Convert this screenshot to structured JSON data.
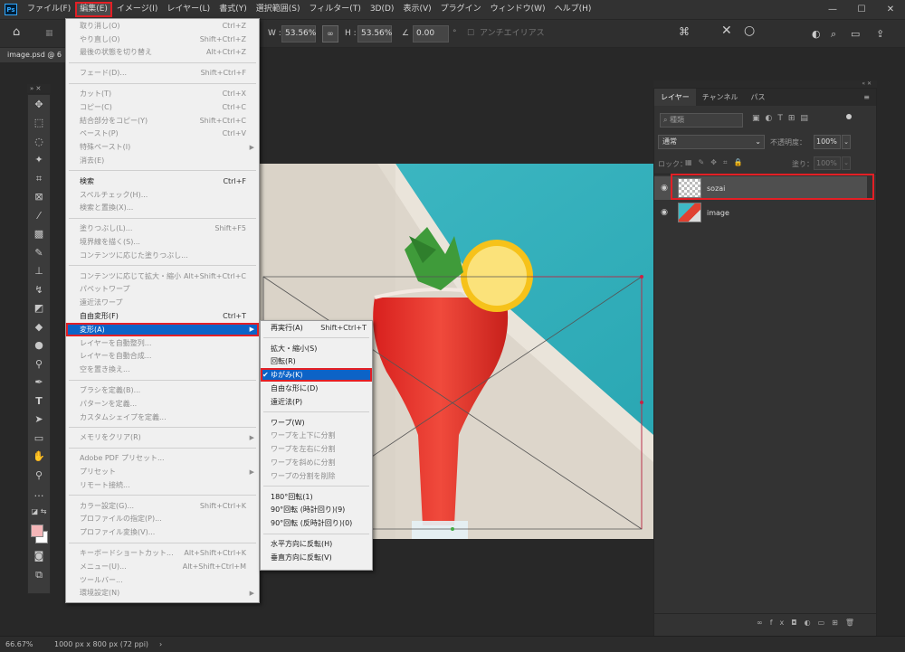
{
  "app": {
    "logo": "Ps"
  },
  "menubar": {
    "items": [
      "ファイル(F)",
      "編集(E)",
      "イメージ(I)",
      "レイヤー(L)",
      "書式(Y)",
      "選択範囲(S)",
      "フィルター(T)",
      "3D(D)",
      "表示(V)",
      "プラグイン",
      "ウィンドウ(W)",
      "ヘルプ(H)"
    ],
    "active_index": 1
  },
  "window_controls": {
    "minimize": "—",
    "restore": "☐",
    "close": "✕"
  },
  "options_bar": {
    "w_label": "W :",
    "w_value": "53.56%",
    "link_icon": "link-icon",
    "h_label": "H :",
    "h_value": "53.56%",
    "angle_value": "0.00",
    "angle_unit": "°",
    "antialias_label": "アンチエイリアス"
  },
  "document": {
    "tab_title": "image.psd @ 6"
  },
  "edit_menu": {
    "groups": [
      [
        {
          "label": "取り消し(O)",
          "shortcut": "Ctrl+Z",
          "enabled": false
        },
        {
          "label": "やり直し(O)",
          "shortcut": "Shift+Ctrl+Z",
          "enabled": false
        },
        {
          "label": "最後の状態を切り替え",
          "shortcut": "Alt+Ctrl+Z",
          "enabled": false
        }
      ],
      [
        {
          "label": "フェード(D)...",
          "shortcut": "Shift+Ctrl+F",
          "enabled": false
        }
      ],
      [
        {
          "label": "カット(T)",
          "shortcut": "Ctrl+X",
          "enabled": false
        },
        {
          "label": "コピー(C)",
          "shortcut": "Ctrl+C",
          "enabled": false
        },
        {
          "label": "結合部分をコピー(Y)",
          "shortcut": "Shift+Ctrl+C",
          "enabled": false
        },
        {
          "label": "ペースト(P)",
          "shortcut": "Ctrl+V",
          "enabled": false
        },
        {
          "label": "特殊ペースト(I)",
          "shortcut": "",
          "enabled": false,
          "submenu": true
        },
        {
          "label": "消去(E)",
          "shortcut": "",
          "enabled": false
        }
      ],
      [
        {
          "label": "検索",
          "shortcut": "Ctrl+F",
          "enabled": true
        },
        {
          "label": "スペルチェック(H)...",
          "shortcut": "",
          "enabled": false
        },
        {
          "label": "検索と置換(X)...",
          "shortcut": "",
          "enabled": false
        }
      ],
      [
        {
          "label": "塗りつぶし(L)...",
          "shortcut": "Shift+F5",
          "enabled": false
        },
        {
          "label": "境界線を描く(S)...",
          "shortcut": "",
          "enabled": false
        },
        {
          "label": "コンテンツに応じた塗りつぶし...",
          "shortcut": "",
          "enabled": false
        }
      ],
      [
        {
          "label": "コンテンツに応じて拡大・縮小",
          "shortcut": "Alt+Shift+Ctrl+C",
          "enabled": false
        },
        {
          "label": "パペットワープ",
          "shortcut": "",
          "enabled": false
        },
        {
          "label": "遠近法ワープ",
          "shortcut": "",
          "enabled": false
        },
        {
          "label": "自由変形(F)",
          "shortcut": "Ctrl+T",
          "enabled": true
        },
        {
          "label": "変形(A)",
          "shortcut": "",
          "enabled": true,
          "submenu": true,
          "highlighted": true
        },
        {
          "label": "レイヤーを自動整列...",
          "shortcut": "",
          "enabled": false
        },
        {
          "label": "レイヤーを自動合成...",
          "shortcut": "",
          "enabled": false
        },
        {
          "label": "空を置き換え...",
          "shortcut": "",
          "enabled": false
        }
      ],
      [
        {
          "label": "ブラシを定義(B)...",
          "shortcut": "",
          "enabled": false
        },
        {
          "label": "パターンを定義...",
          "shortcut": "",
          "enabled": false
        },
        {
          "label": "カスタムシェイプを定義...",
          "shortcut": "",
          "enabled": false
        }
      ],
      [
        {
          "label": "メモリをクリア(R)",
          "shortcut": "",
          "enabled": false,
          "submenu": true
        }
      ],
      [
        {
          "label": "Adobe PDF プリセット...",
          "shortcut": "",
          "enabled": false
        },
        {
          "label": "プリセット",
          "shortcut": "",
          "enabled": false,
          "submenu": true
        },
        {
          "label": "リモート接続...",
          "shortcut": "",
          "enabled": false
        }
      ],
      [
        {
          "label": "カラー設定(G)...",
          "shortcut": "Shift+Ctrl+K",
          "enabled": false
        },
        {
          "label": "プロファイルの指定(P)...",
          "shortcut": "",
          "enabled": false
        },
        {
          "label": "プロファイル変換(V)...",
          "shortcut": "",
          "enabled": false
        }
      ],
      [
        {
          "label": "キーボードショートカット...",
          "shortcut": "Alt+Shift+Ctrl+K",
          "enabled": false
        },
        {
          "label": "メニュー(U)...",
          "shortcut": "Alt+Shift+Ctrl+M",
          "enabled": false
        },
        {
          "label": "ツールバー...",
          "shortcut": "",
          "enabled": false
        },
        {
          "label": "環境設定(N)",
          "shortcut": "",
          "enabled": false,
          "submenu": true
        }
      ]
    ]
  },
  "transform_submenu": {
    "groups": [
      [
        {
          "label": "再実行(A)",
          "shortcut": "Shift+Ctrl+T",
          "enabled": true
        }
      ],
      [
        {
          "label": "拡大・縮小(S)",
          "enabled": true
        },
        {
          "label": "回転(R)",
          "enabled": true
        },
        {
          "label": "ゆがみ(K)",
          "enabled": true,
          "checked": true,
          "highlighted": true
        },
        {
          "label": "自由な形に(D)",
          "enabled": true
        },
        {
          "label": "遠近法(P)",
          "enabled": true
        }
      ],
      [
        {
          "label": "ワープ(W)",
          "enabled": true
        },
        {
          "label": "ワープを上下に分割",
          "enabled": false
        },
        {
          "label": "ワープを左右に分割",
          "enabled": false
        },
        {
          "label": "ワープを斜めに分割",
          "enabled": false
        },
        {
          "label": "ワープの分割を削除",
          "enabled": false
        }
      ],
      [
        {
          "label": "180°回転(1)",
          "enabled": true
        },
        {
          "label": "90°回転 (時計回り)(9)",
          "enabled": true
        },
        {
          "label": "90°回転 (反時計回り)(0)",
          "enabled": true
        }
      ],
      [
        {
          "label": "水平方向に反転(H)",
          "enabled": true
        },
        {
          "label": "垂直方向に反転(V)",
          "enabled": true
        }
      ]
    ]
  },
  "layers_panel": {
    "tabs": [
      "レイヤー",
      "チャンネル",
      "パス"
    ],
    "search_placeholder": "種類",
    "blend_mode": "通常",
    "opacity_label": "不透明度：",
    "opacity_value": "100%",
    "lock_label": "ロック：",
    "fill_label": "塗り：",
    "fill_value": "100%",
    "layers": [
      {
        "name": "sozai",
        "selected": true
      },
      {
        "name": "image",
        "selected": false
      }
    ]
  },
  "status": {
    "zoom": "66.67%",
    "doc_info": "1000 px x 800 px (72 ppi)"
  },
  "colors": {
    "highlight": "#0c63c7",
    "annotation": "#e31f25",
    "foreground": "#f4b6b8",
    "background": "#ffffff"
  }
}
